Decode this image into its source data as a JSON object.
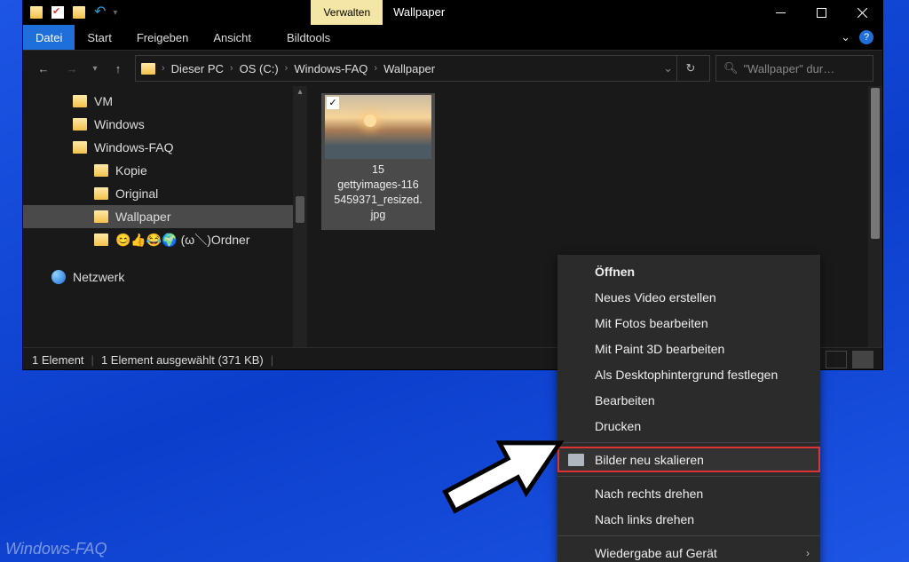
{
  "titlebar": {
    "manage_tab": "Verwalten",
    "window_title": "Wallpaper"
  },
  "tabs": {
    "file": "Datei",
    "start": "Start",
    "share": "Freigeben",
    "view": "Ansicht",
    "picturetools": "Bildtools"
  },
  "breadcrumb": {
    "pc": "Dieser PC",
    "drive": "OS (C:)",
    "folder1": "Windows-FAQ",
    "folder2": "Wallpaper",
    "dropdown_glyph": "⌄"
  },
  "search": {
    "placeholder": "\"Wallpaper\" dur…"
  },
  "tree": {
    "items": [
      {
        "label": "VM",
        "indent": 56
      },
      {
        "label": "Windows",
        "indent": 56
      },
      {
        "label": "Windows-FAQ",
        "indent": 56
      },
      {
        "label": "Kopie",
        "indent": 80
      },
      {
        "label": "Original",
        "indent": 80
      },
      {
        "label": "Wallpaper",
        "indent": 80,
        "selected": true
      },
      {
        "label": "😊👍😂🌍 (ω＼)Ordner",
        "indent": 80
      }
    ],
    "network": "Netzwerk"
  },
  "file_item": {
    "line1": "15",
    "line2": "gettyimages-116",
    "line3": "5459371_resized.",
    "line4": "jpg"
  },
  "status": {
    "count": "1 Element",
    "selection": "1 Element ausgewählt (371 KB)"
  },
  "context_menu": {
    "open": "Öffnen",
    "new_video": "Neues Video erstellen",
    "edit_photos": "Mit Fotos bearbeiten",
    "paint3d": "Mit Paint 3D bearbeiten",
    "set_wallpaper": "Als Desktophintergrund festlegen",
    "edit": "Bearbeiten",
    "print": "Drucken",
    "resize": "Bilder neu skalieren",
    "rotate_right": "Nach rechts drehen",
    "rotate_left": "Nach links drehen",
    "playback": "Wiedergabe auf Gerät"
  },
  "watermark": "Windows-FAQ"
}
